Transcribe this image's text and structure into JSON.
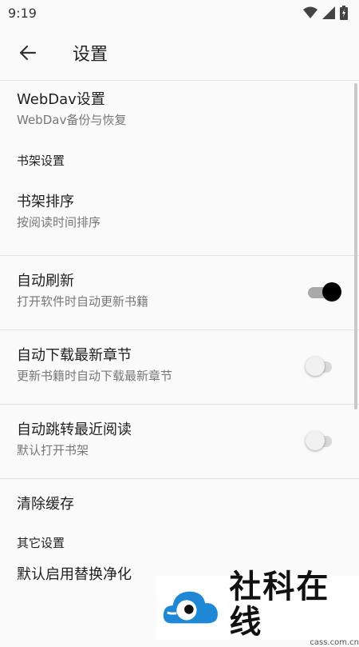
{
  "status": {
    "time": "9:19"
  },
  "toolbar": {
    "title": "设置"
  },
  "items": {
    "webdav": {
      "title": "WebDav设置",
      "subtitle": "WebDav备份与恢复"
    },
    "bookshelf_category": "书架设置",
    "shelf_sort": {
      "title": "书架排序",
      "subtitle": "按阅读时间排序"
    },
    "auto_refresh": {
      "title": "自动刷新",
      "subtitle": "打开软件时自动更新书籍",
      "enabled": true
    },
    "auto_download": {
      "title": "自动下载最新章节",
      "subtitle": "更新书籍时自动下载最新章节",
      "enabled": false
    },
    "auto_jump": {
      "title": "自动跳转最近阅读",
      "subtitle": "默认打开书架",
      "enabled": false
    },
    "clear_cache": {
      "title": "清除缓存"
    },
    "other_category": "其它设置",
    "default_replace": {
      "title": "默认启用替换净化"
    }
  },
  "watermark": {
    "name": "社科在线",
    "site": "cass.com.cn"
  },
  "colors": {
    "switch_on": "#000000",
    "switch_track_on": "#a9a9a9",
    "switch_off": "#f1f1f1",
    "logo_blue": "#1e88d6"
  }
}
